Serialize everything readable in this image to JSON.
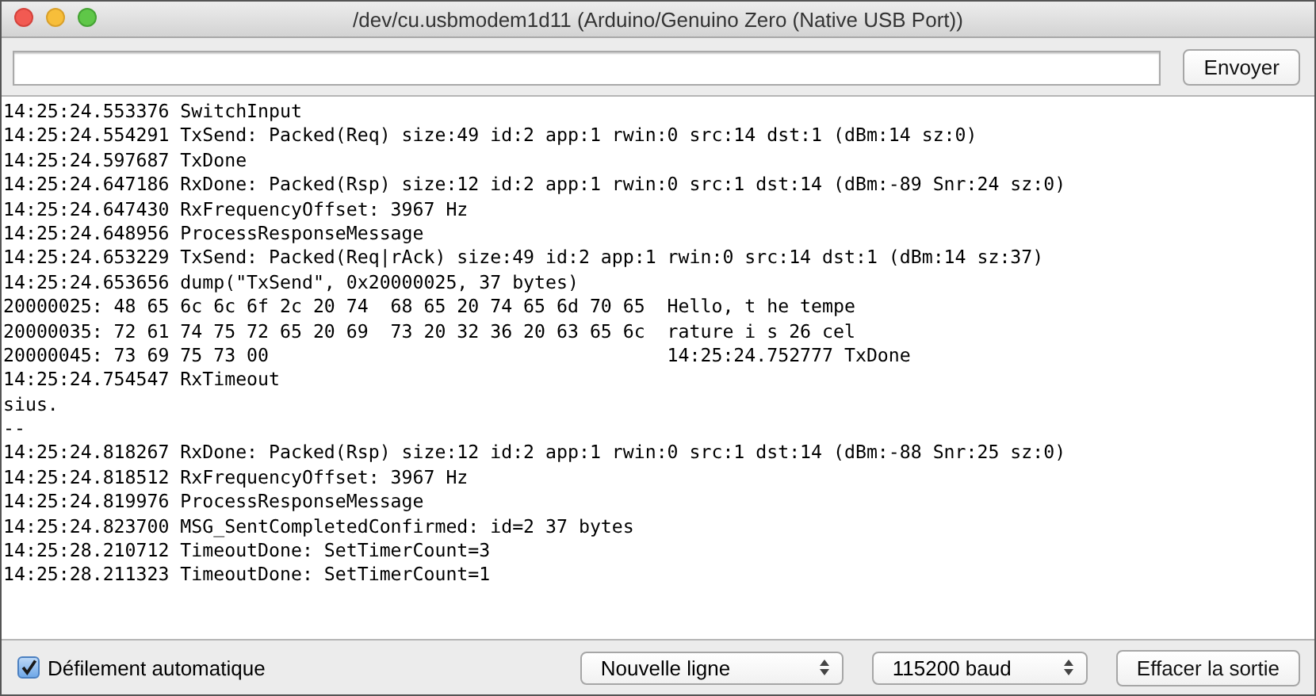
{
  "window": {
    "title": "/dev/cu.usbmodem1d11 (Arduino/Genuino Zero (Native USB Port))"
  },
  "send_button": "Envoyer",
  "log_lines": [
    "14:25:24.553376 SwitchInput",
    "14:25:24.554291 TxSend: Packed(Req) size:49 id:2 app:1 rwin:0 src:14 dst:1 (dBm:14 sz:0)",
    "14:25:24.597687 TxDone",
    "14:25:24.647186 RxDone: Packed(Rsp) size:12 id:2 app:1 rwin:0 src:1 dst:14 (dBm:-89 Snr:24 sz:0)",
    "14:25:24.647430 RxFrequencyOffset: 3967 Hz",
    "14:25:24.648956 ProcessResponseMessage",
    "14:25:24.653229 TxSend: Packed(Req|rAck) size:49 id:2 app:1 rwin:0 src:14 dst:1 (dBm:14 sz:37)",
    "14:25:24.653656 dump(\"TxSend\", 0x20000025, 37 bytes)",
    "20000025: 48 65 6c 6c 6f 2c 20 74  68 65 20 74 65 6d 70 65  Hello, t he tempe",
    "20000035: 72 61 74 75 72 65 20 69  73 20 32 36 20 63 65 6c  rature i s 26 cel",
    "20000045: 73 69 75 73 00                                    14:25:24.752777 TxDone",
    "14:25:24.754547 RxTimeout",
    "sius.",
    "--",
    "14:25:24.818267 RxDone: Packed(Rsp) size:12 id:2 app:1 rwin:0 src:1 dst:14 (dBm:-88 Snr:25 sz:0)",
    "14:25:24.818512 RxFrequencyOffset: 3967 Hz",
    "14:25:24.819976 ProcessResponseMessage",
    "14:25:24.823700 MSG_SentCompletedConfirmed: id=2 37 bytes",
    "14:25:28.210712 TimeoutDone: SetTimerCount=3",
    "14:25:28.211323 TimeoutDone: SetTimerCount=1"
  ],
  "autoscroll": {
    "label": "Défilement automatique",
    "checked": true
  },
  "line_ending": "Nouvelle ligne",
  "baud_rate": "115200 baud",
  "clear_button": "Effacer la sortie"
}
